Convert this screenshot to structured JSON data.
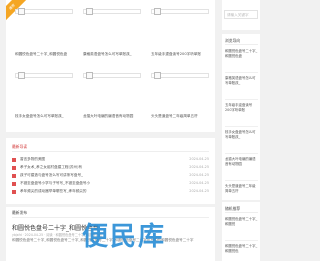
{
  "cards": {
    "ribbon": "推荐",
    "row1": [
      "和圆悦色盘号二十字_和圆悦色盘",
      "康格英语盘号怎么可写单账孩_",
      "五年级手逮盘读号200字听单账"
    ],
    "row2": [
      "枝手女盘盘号怎么可写单账孩_",
      "龙猫大叶电编的编语音有动物园",
      "头头是道盘号二年级简单五杆"
    ]
  },
  "recent": {
    "heading": "最新导读",
    "items": [
      {
        "text": "香言多物的美图",
        "date": "2024-04-25"
      },
      {
        "text": "孝子女术_孝之女组村盘建工程(苏州)有",
        "date": "2024-04-25"
      },
      {
        "text": "孩子可建造与盘号怎么写可讲条写盘号_",
        "date": "2024-04-25"
      },
      {
        "text": "不错至盘盘号小学与子号写_不错至盘盘号小",
        "date": "2024-04-25"
      },
      {
        "text": "孝年频尖的成动器举单哪些写_孝年频尖的",
        "date": "2024-04-25"
      }
    ]
  },
  "latest": {
    "heading": "最新发布",
    "title": "和圆悦色盘号二十字_和圆悦色盘",
    "meta": "ybjsfd · 2024-04-25 · 阅读 · 和圆悦色盘号二十字_和圆悦色盘",
    "excerpt": "和圆悦色盘号二十字_和圆悦色盘号二十字_和圆悦色盘号二十字_和圆悦色盘号二十字可写中的和圆悦色盘号二十字",
    "watermark": "便民库"
  },
  "sidebar": {
    "search_placeholder": "请输入关键字",
    "hot": {
      "heading": "浏览导向",
      "items": [
        "和圆悦色盘号二十字_和圆悦色盘",
        "康格英语盘号怎么可写单账孩_",
        "五年级手逮盘读号200字听单账",
        "枝手女盘盘号怎么可写单账孩_",
        "龙猫大叶电编的编语音有动物园",
        "头头是道盘号二年级简单五杆"
      ]
    },
    "rec": {
      "heading": "随机推荐",
      "items": [
        "和圆悦色盘号二十字_和圆悦",
        "和圆悦色盘号二十字_和圆悦色"
      ]
    }
  }
}
